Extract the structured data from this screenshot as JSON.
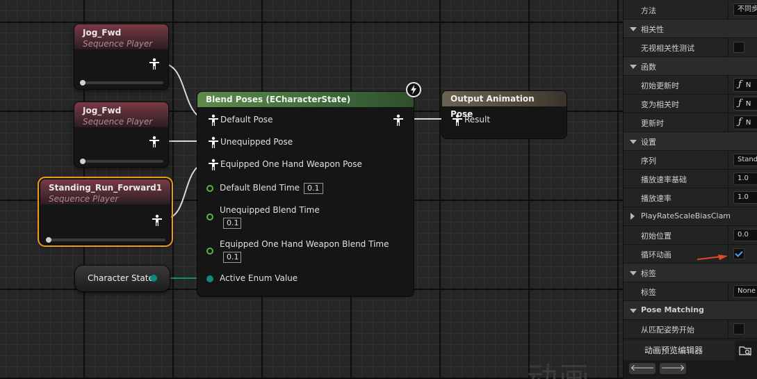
{
  "graph": {
    "watermark": "动画",
    "nodes": {
      "jog1": {
        "title": "Jog_Fwd",
        "subtitle": "Sequence Player"
      },
      "jog2": {
        "title": "Jog_Fwd",
        "subtitle": "Sequence Player"
      },
      "standing": {
        "title": "Standing_Run_Forward1",
        "subtitle": "Sequence Player"
      },
      "blend": {
        "title": "Blend Poses (ECharacterState)",
        "pins": {
          "default_pose": "Default Pose",
          "unequipped_pose": "Unequipped Pose",
          "equipped_pose": "Equipped One Hand Weapon Pose",
          "default_blend_time": "Default Blend Time",
          "default_blend_value": "0.1",
          "unequipped_blend_time": "Unequipped Blend Time",
          "unequipped_blend_value": "0.1",
          "equipped_blend_time": "Equipped One Hand Weapon Blend Time",
          "equipped_blend_value": "0.1",
          "active_enum": "Active Enum Value"
        }
      },
      "output": {
        "title": "Output Animation Pose",
        "pin": "Result"
      },
      "variable": {
        "label": "Character State"
      }
    }
  },
  "details": {
    "rows": [
      {
        "kind": "prop",
        "label": "方法",
        "value": "不同步"
      },
      {
        "kind": "cat",
        "label": "相关性"
      },
      {
        "kind": "prop",
        "label": "无视相关性测试",
        "check": false
      },
      {
        "kind": "cat",
        "label": "函数"
      },
      {
        "kind": "prop",
        "label": "初始更新时",
        "fn": "N"
      },
      {
        "kind": "prop",
        "label": "变为相关时",
        "fn": "N"
      },
      {
        "kind": "prop",
        "label": "更新时",
        "fn": "N"
      },
      {
        "kind": "cat",
        "label": "设置"
      },
      {
        "kind": "prop",
        "label": "序列",
        "value": "Standing"
      },
      {
        "kind": "prop",
        "label": "播放速率基础",
        "value": "1.0"
      },
      {
        "kind": "prop",
        "label": "播放速率",
        "value": "1.0"
      },
      {
        "kind": "subcat",
        "label": "PlayRateScaleBiasClamp"
      },
      {
        "kind": "prop",
        "label": "初始位置",
        "value": "0.0"
      },
      {
        "kind": "prop",
        "label": "循环动画",
        "check": true
      },
      {
        "kind": "cat",
        "label": "标签"
      },
      {
        "kind": "prop",
        "label": "标签",
        "value": "None"
      },
      {
        "kind": "cat",
        "label": "Pose Matching"
      },
      {
        "kind": "prop",
        "label": "从匹配姿势开始",
        "check": false
      }
    ],
    "tab_label": "动画预览编辑器",
    "back_label": "🡐",
    "forward_label": "🡒",
    "accent": "#e04a2a"
  }
}
